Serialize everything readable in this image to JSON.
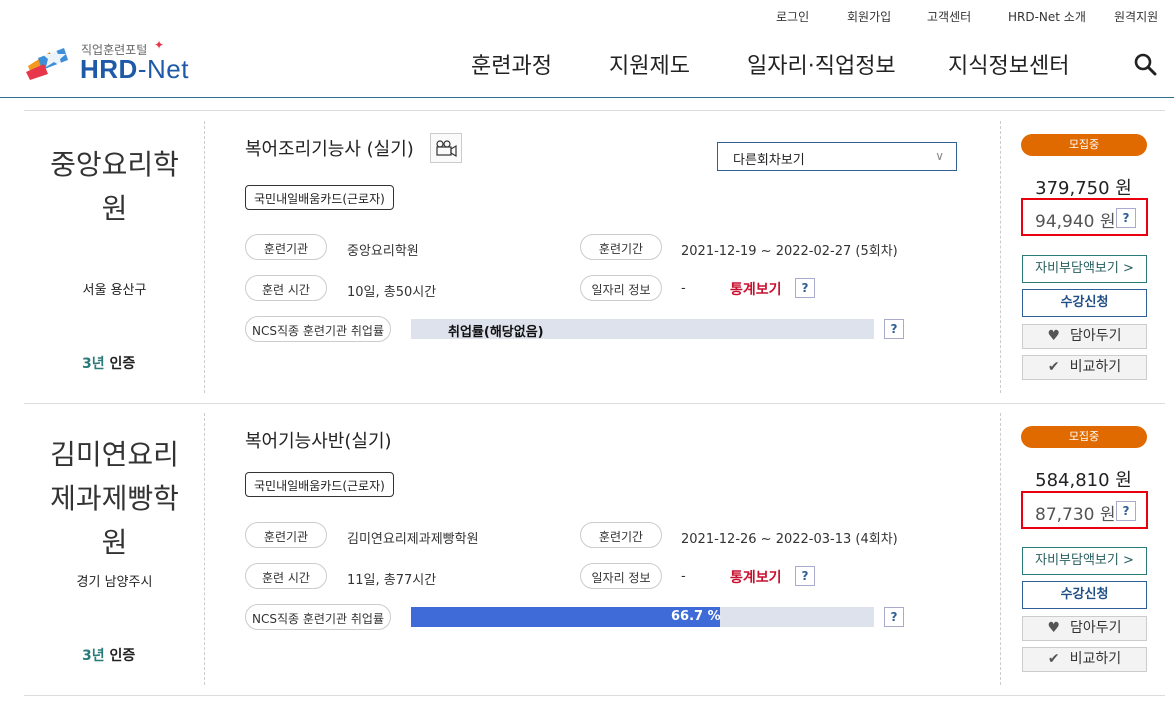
{
  "header": {
    "util_links": [
      "로그인",
      "회원가입",
      "고객센터",
      "HRD-Net 소개",
      "원격지원"
    ],
    "logo_small": "직업훈련포털",
    "logo_big_a": "HRD",
    "logo_big_b": "-Net",
    "nav": [
      "훈련과정",
      "지원제도",
      "일자리·직업정보",
      "지식정보센터"
    ]
  },
  "courses": [
    {
      "institution": "중앙요리학원",
      "institution_lines": [
        "중앙요리학",
        "원"
      ],
      "location": "서울 용산구",
      "cert_year": "3년",
      "cert_label": "인증",
      "title": "복어조리기능사 (실기)",
      "other_rounds": "다른회차보기",
      "badge": "국민내일배움카드(근로자)",
      "org_label": "훈련기관",
      "org_value": "중앙요리학원",
      "period_label": "훈련기간",
      "period_value": "2021-12-19 ~ 2022-02-27 (5회차)",
      "hours_label": "훈련 시간",
      "hours_value": "10일, 총50시간",
      "job_label": "일자리 정보",
      "job_value": "-",
      "stats_link": "통계보기",
      "employ_label": "NCS직종 훈련기관 취업률",
      "employ_text": "취업률(해당없음)",
      "employ_rate": 0,
      "status": "모집중",
      "price": "379,750 원",
      "self_pay": "94,940 원",
      "btn_self_pay": "자비부담액보기 >",
      "btn_apply": "수강신청",
      "btn_wish": "담아두기",
      "btn_compare": "비교하기"
    },
    {
      "institution": "김미연요리제과제빵학원",
      "institution_lines": [
        "김미연요리",
        "제과제빵학",
        "원"
      ],
      "location": "경기 남양주시",
      "cert_year": "3년",
      "cert_label": "인증",
      "title": "복어기능사반(실기)",
      "badge": "국민내일배움카드(근로자)",
      "org_label": "훈련기관",
      "org_value": "김미연요리제과제빵학원",
      "period_label": "훈련기간",
      "period_value": "2021-12-26 ~ 2022-03-13 (4회차)",
      "hours_label": "훈련 시간",
      "hours_value": "11일, 총77시간",
      "job_label": "일자리 정보",
      "job_value": "-",
      "stats_link": "통계보기",
      "employ_label": "NCS직종 훈련기관 취업률",
      "employ_text": "66.7 %",
      "employ_rate": 66.7,
      "status": "모집중",
      "price": "584,810 원",
      "self_pay": "87,730 원",
      "btn_self_pay": "자비부담액보기 >",
      "btn_apply": "수강신청",
      "btn_wish": "담아두기",
      "btn_compare": "비교하기"
    }
  ],
  "help_glyph": "?",
  "colors": {
    "accent_orange": "#e16a00",
    "highlight_red": "#e8000f",
    "bar_fill": "#3e6bd8",
    "stats_red": "#c8102e"
  }
}
